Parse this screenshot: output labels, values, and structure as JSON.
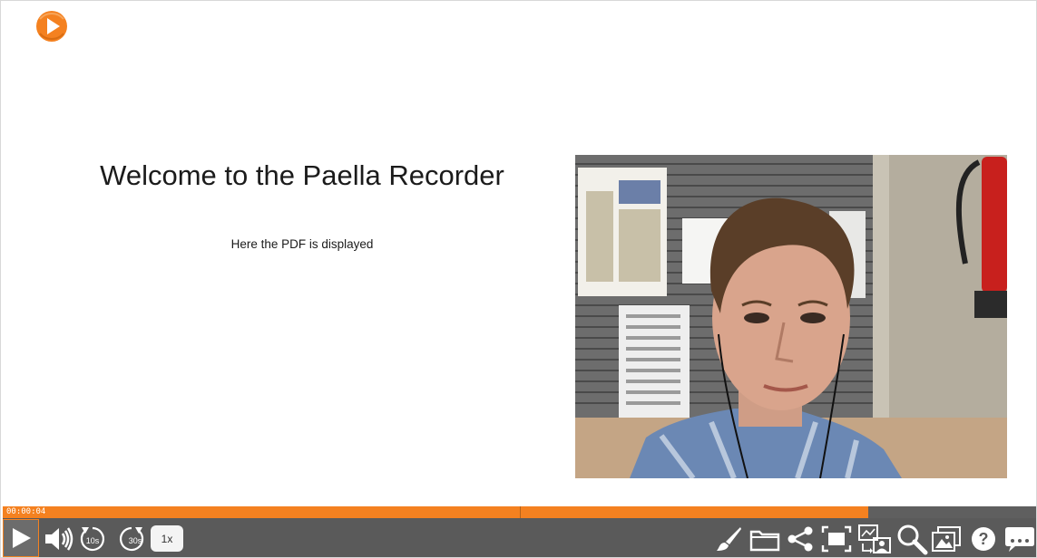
{
  "player": {
    "brand_color": "#f48120",
    "logo_icon": "play-circle-icon"
  },
  "slide": {
    "title": "Welcome to the Paella Recorder",
    "subtitle": "Here the PDF is displayed"
  },
  "camera": {
    "description_icon": "presenter-video-icon"
  },
  "progress": {
    "current_time": "00:00:04",
    "played_fraction": 0.837
  },
  "controls": {
    "play_icon": "play-icon",
    "volume_icon": "volume-icon",
    "rewind_label": "10s",
    "forward_label": "30s",
    "speed_label": "1x",
    "right_icons": [
      "annotate-icon",
      "downloads-icon",
      "share-icon",
      "fullscreen-icon",
      "layout-icon",
      "search-icon",
      "frames-icon",
      "help-icon",
      "captions-icon"
    ]
  }
}
